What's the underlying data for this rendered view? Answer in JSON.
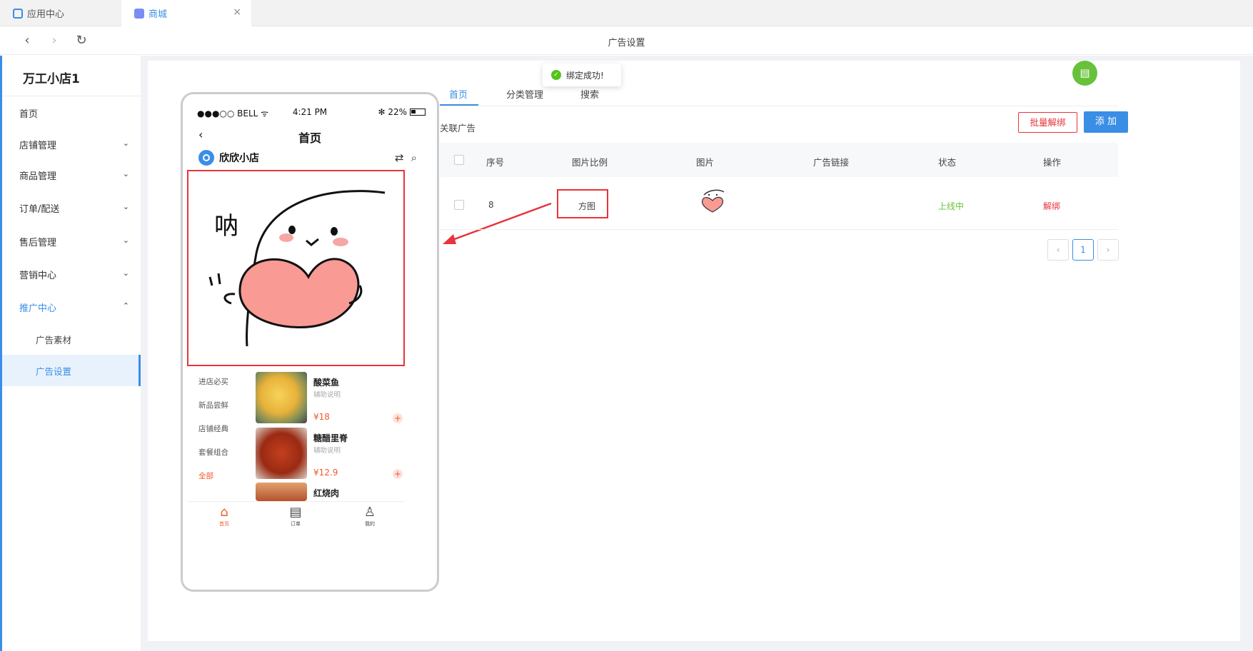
{
  "tabs": [
    {
      "label": "应用中心"
    },
    {
      "label": "商城",
      "close": "×"
    }
  ],
  "nav": {
    "title": "广告设置",
    "back": "‹",
    "forward": "›",
    "reload": "↻"
  },
  "sidebar": {
    "shop_name": "万工小店1",
    "items": [
      {
        "label": "首页"
      },
      {
        "label": "店铺管理",
        "chevron": "⌄"
      },
      {
        "label": "商品管理",
        "chevron": "⌄"
      },
      {
        "label": "订单/配送",
        "chevron": "⌄"
      },
      {
        "label": "售后管理",
        "chevron": "⌄"
      },
      {
        "label": "营销中心",
        "chevron": "⌄"
      },
      {
        "label": "推广中心",
        "chevron": "⌃"
      }
    ],
    "sub_items": [
      {
        "label": "广告素材"
      },
      {
        "label": "广告设置"
      }
    ]
  },
  "toast": {
    "text": "绑定成功!",
    "icon": "✓"
  },
  "phone": {
    "carrier": "●●●○○ BELL ᯤ",
    "time": "4:21 PM",
    "battery": "✻ 22%",
    "back": "‹",
    "title": "首页",
    "shop": "欣欣小店",
    "icons": "⇄⌕",
    "ad_text": "呐",
    "categories": [
      "进店必买",
      "新品尝鲜",
      "店铺经典",
      "套餐组合",
      "全部"
    ],
    "products": [
      {
        "name": "酸菜鱼",
        "desc": "辅助说明",
        "price": "¥18",
        "plus": "+"
      },
      {
        "name": "糖醋里脊",
        "desc": "辅助说明",
        "price": "¥12.9",
        "plus": "+"
      },
      {
        "name": "红烧肉"
      }
    ],
    "bottom_tabs": [
      {
        "label": "首页",
        "icon": "⌂"
      },
      {
        "label": "订单",
        "icon": "▤"
      },
      {
        "label": "我的",
        "icon": "♙"
      }
    ]
  },
  "content": {
    "tabs": [
      "首页",
      "分类管理",
      "搜索"
    ],
    "section_title": "关联广告",
    "batch_unbind": "批量解绑",
    "add": "添 加",
    "table": {
      "headers": [
        "序号",
        "图片比例",
        "图片",
        "广告链接",
        "状态",
        "操作"
      ],
      "rows": [
        {
          "seq": "8",
          "ratio": "方图",
          "link": "",
          "status": "上线中",
          "op": "解绑"
        }
      ]
    },
    "pager": {
      "prev": "‹",
      "current": "1",
      "next": "›"
    }
  }
}
